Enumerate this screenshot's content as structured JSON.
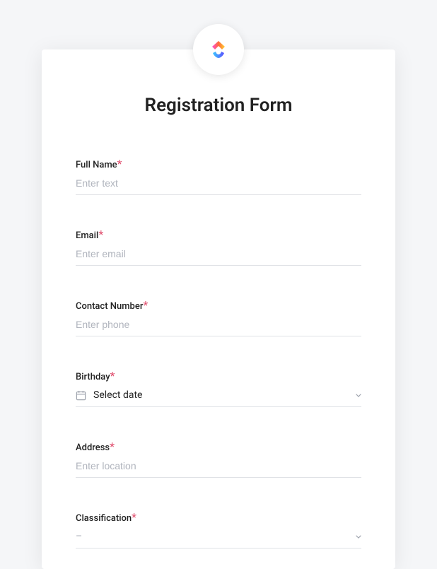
{
  "title": "Registration Form",
  "fields": {
    "full_name": {
      "label": "Full Name",
      "required": "*",
      "placeholder": "Enter text",
      "value": ""
    },
    "email": {
      "label": "Email",
      "required": "*",
      "placeholder": "Enter email",
      "value": ""
    },
    "contact": {
      "label": "Contact Number",
      "required": "*",
      "placeholder": "Enter phone",
      "value": ""
    },
    "birthday": {
      "label": "Birthday",
      "required": "*",
      "placeholder": "Select date"
    },
    "address": {
      "label": "Address",
      "required": "*",
      "placeholder": "Enter location",
      "value": ""
    },
    "classification": {
      "label": "Classification",
      "required": "*",
      "placeholder": "–"
    }
  }
}
